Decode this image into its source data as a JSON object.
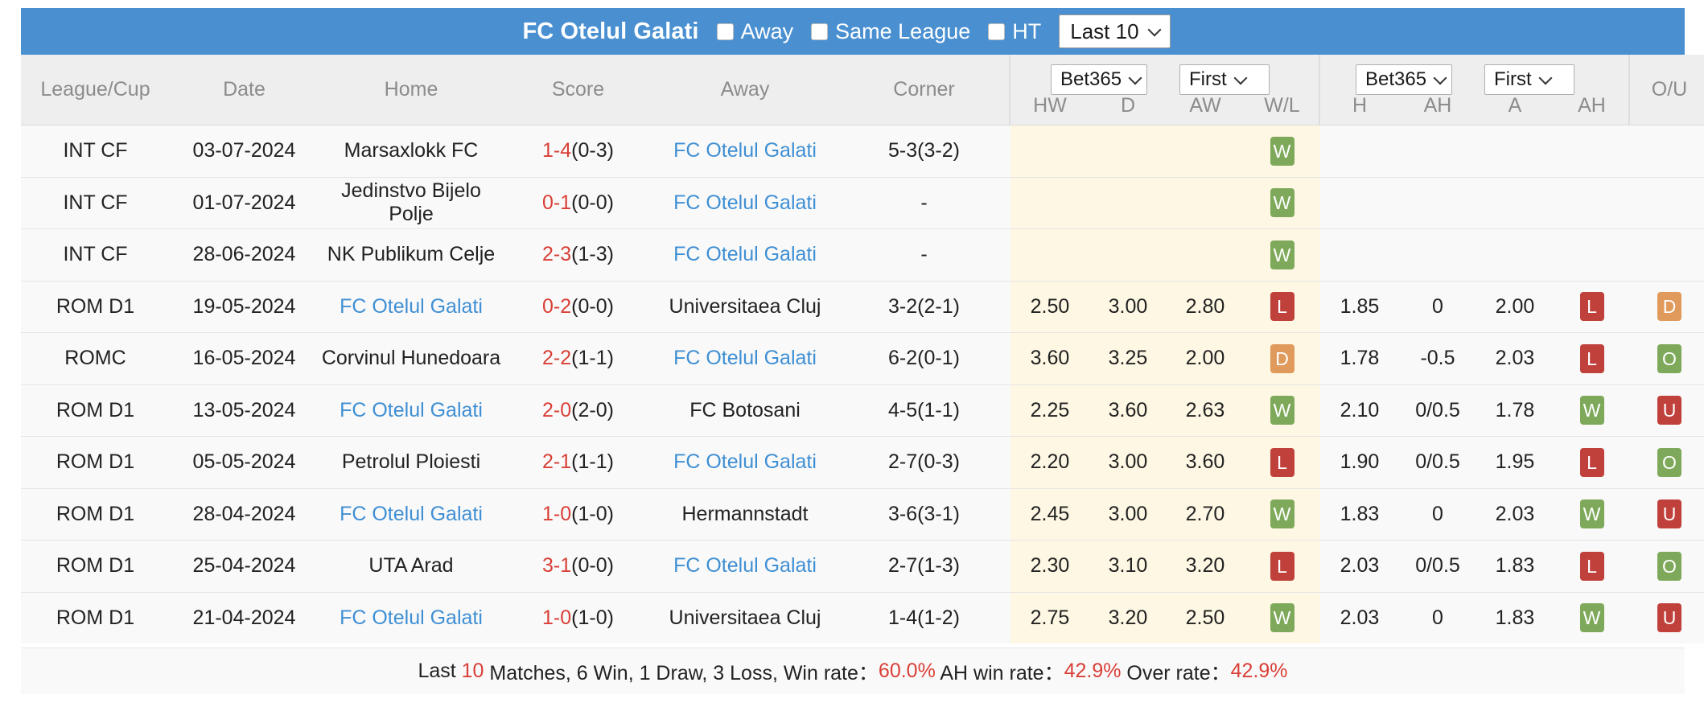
{
  "header": {
    "team": "FC Otelul Galati",
    "filters": [
      {
        "label": "Away",
        "checked": false
      },
      {
        "label": "Same League",
        "checked": false
      },
      {
        "label": "HT",
        "checked": false
      }
    ],
    "range_select": {
      "value": "Last 10",
      "icon": "chevron-down-icon"
    },
    "bar_color": "#4a90d1"
  },
  "table": {
    "columns": [
      "League/Cup",
      "Date",
      "Home",
      "Score",
      "Away",
      "Corner",
      "HW",
      "D",
      "AW",
      "W/L",
      "H",
      "AH",
      "A",
      "AH",
      "O/U"
    ],
    "odds_selects": [
      {
        "name": "bookmaker-1x2",
        "value": "Bet365"
      },
      {
        "name": "period-1x2",
        "value": "First"
      },
      {
        "name": "bookmaker-ah",
        "value": "Bet365"
      },
      {
        "name": "period-ah",
        "value": "First"
      }
    ],
    "rows": [
      {
        "league": "INT CF",
        "date": "03-07-2024",
        "home": "Marsaxlokk FC",
        "home_link": false,
        "score": "1-4",
        "score_ht": "(0-3)",
        "away": "FC Otelul Galati",
        "away_link": true,
        "corner": "5-3(3-2)",
        "hw": "",
        "d": "",
        "aw": "",
        "wl": "W",
        "h": "",
        "ah1": "",
        "a": "",
        "ah2": "",
        "ou": ""
      },
      {
        "league": "INT CF",
        "date": "01-07-2024",
        "home": "Jedinstvo Bijelo Polje",
        "home_link": false,
        "score": "0-1",
        "score_ht": "(0-0)",
        "away": "FC Otelul Galati",
        "away_link": true,
        "corner": "-",
        "hw": "",
        "d": "",
        "aw": "",
        "wl": "W",
        "h": "",
        "ah1": "",
        "a": "",
        "ah2": "",
        "ou": ""
      },
      {
        "league": "INT CF",
        "date": "28-06-2024",
        "home": "NK Publikum Celje",
        "home_link": false,
        "score": "2-3",
        "score_ht": "(1-3)",
        "away": "FC Otelul Galati",
        "away_link": true,
        "corner": "-",
        "hw": "",
        "d": "",
        "aw": "",
        "wl": "W",
        "h": "",
        "ah1": "",
        "a": "",
        "ah2": "",
        "ou": ""
      },
      {
        "league": "ROM D1",
        "date": "19-05-2024",
        "home": "FC Otelul Galati",
        "home_link": true,
        "score": "0-2",
        "score_ht": "(0-0)",
        "away": "Universitaea Cluj",
        "away_link": false,
        "corner": "3-2(2-1)",
        "hw": "2.50",
        "d": "3.00",
        "aw": "2.80",
        "wl": "L",
        "h": "1.85",
        "ah1": "0",
        "a": "2.00",
        "ah2": "L",
        "ou": "D"
      },
      {
        "league": "ROMC",
        "date": "16-05-2024",
        "home": "Corvinul Hunedoara",
        "home_link": false,
        "score": "2-2",
        "score_ht": "(1-1)",
        "away": "FC Otelul Galati",
        "away_link": true,
        "corner": "6-2(0-1)",
        "hw": "3.60",
        "d": "3.25",
        "aw": "2.00",
        "wl": "D",
        "h": "1.78",
        "ah1": "-0.5",
        "a": "2.03",
        "ah2": "L",
        "ou": "O"
      },
      {
        "league": "ROM D1",
        "date": "13-05-2024",
        "home": "FC Otelul Galati",
        "home_link": true,
        "score": "2-0",
        "score_ht": "(2-0)",
        "away": "FC Botosani",
        "away_link": false,
        "corner": "4-5(1-1)",
        "hw": "2.25",
        "d": "3.60",
        "aw": "2.63",
        "wl": "W",
        "h": "2.10",
        "ah1": "0/0.5",
        "a": "1.78",
        "ah2": "W",
        "ou": "U"
      },
      {
        "league": "ROM D1",
        "date": "05-05-2024",
        "home": "Petrolul Ploiesti",
        "home_link": false,
        "score": "2-1",
        "score_ht": "(1-1)",
        "away": "FC Otelul Galati",
        "away_link": true,
        "corner": "2-7(0-3)",
        "hw": "2.20",
        "d": "3.00",
        "aw": "3.60",
        "wl": "L",
        "h": "1.90",
        "ah1": "0/0.5",
        "a": "1.95",
        "ah2": "L",
        "ou": "O"
      },
      {
        "league": "ROM D1",
        "date": "28-04-2024",
        "home": "FC Otelul Galati",
        "home_link": true,
        "score": "1-0",
        "score_ht": "(1-0)",
        "away": "Hermannstadt",
        "away_link": false,
        "corner": "3-6(3-1)",
        "hw": "2.45",
        "d": "3.00",
        "aw": "2.70",
        "wl": "W",
        "h": "1.83",
        "ah1": "0",
        "a": "2.03",
        "ah2": "W",
        "ou": "U"
      },
      {
        "league": "ROM D1",
        "date": "25-04-2024",
        "home": "UTA Arad",
        "home_link": false,
        "score": "3-1",
        "score_ht": "(0-0)",
        "away": "FC Otelul Galati",
        "away_link": true,
        "corner": "2-7(1-3)",
        "hw": "2.30",
        "d": "3.10",
        "aw": "3.20",
        "wl": "L",
        "h": "2.03",
        "ah1": "0/0.5",
        "a": "1.83",
        "ah2": "L",
        "ou": "O"
      },
      {
        "league": "ROM D1",
        "date": "21-04-2024",
        "home": "FC Otelul Galati",
        "home_link": true,
        "score": "1-0",
        "score_ht": "(1-0)",
        "away": "Universitaea Cluj",
        "away_link": false,
        "corner": "1-4(1-2)",
        "hw": "2.75",
        "d": "3.20",
        "aw": "2.50",
        "wl": "W",
        "h": "2.03",
        "ah1": "0",
        "a": "1.83",
        "ah2": "W",
        "ou": "U"
      }
    ]
  },
  "footer": {
    "t1": "Last ",
    "matches_count": "10",
    "t2": " Matches, 6 Win, 1 Draw, 3 Loss, Win rate：",
    "win_rate": "60.0%",
    "t3": " AH win rate：",
    "ah_win_rate": "42.9%",
    "t4": " Over rate：",
    "over_rate": "42.9%"
  },
  "colors": {
    "accent": "#4a90d1",
    "win": "#7fa95a",
    "loss": "#c0413b",
    "draw": "#e09a5c",
    "score": "#d93f37",
    "link": "#3f8fd4",
    "highlight": "#fdf7e3"
  }
}
